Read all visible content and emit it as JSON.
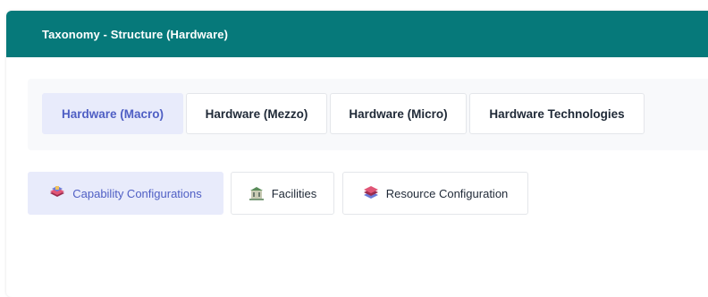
{
  "header": {
    "title": "Taxonomy - Structure (Hardware)"
  },
  "tabs": [
    {
      "label": "Hardware (Macro)",
      "active": true
    },
    {
      "label": "Hardware (Mezzo)",
      "active": false
    },
    {
      "label": "Hardware (Micro)",
      "active": false
    },
    {
      "label": "Hardware Technologies",
      "active": false
    }
  ],
  "subtabs": [
    {
      "label": "Capability Configurations",
      "icon": "layers-icon",
      "active": true
    },
    {
      "label": "Facilities",
      "icon": "building-icon",
      "active": false
    },
    {
      "label": "Resource Configuration",
      "icon": "stack-icon",
      "active": false
    }
  ],
  "colors": {
    "header_bg": "#06797a",
    "active_bg": "#e8ebfb",
    "active_text": "#4f5fc4"
  }
}
